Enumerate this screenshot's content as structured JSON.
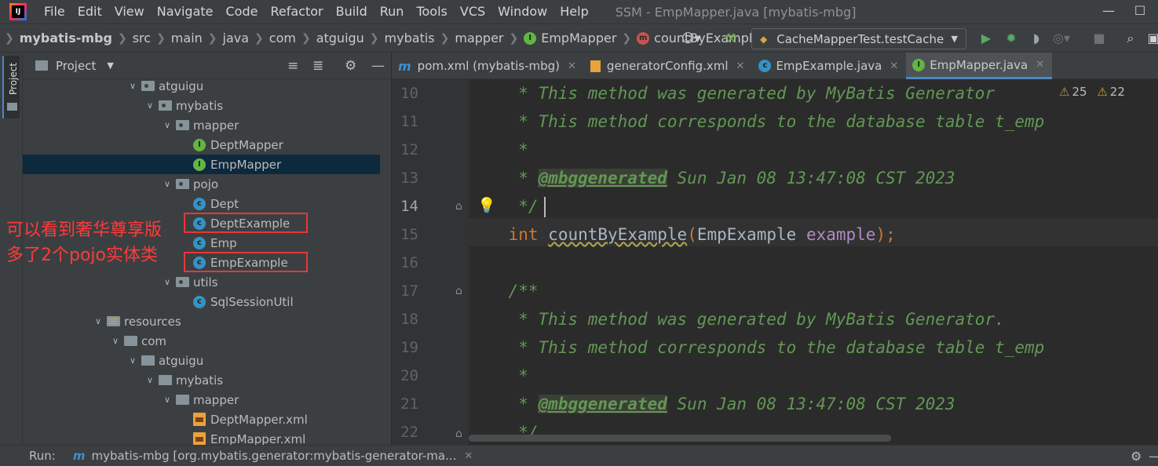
{
  "menubar": {
    "items": [
      "File",
      "Edit",
      "View",
      "Navigate",
      "Code",
      "Refactor",
      "Build",
      "Run",
      "Tools",
      "VCS",
      "Window",
      "Help"
    ],
    "window_title": "SSM - EmpMapper.java [mybatis-mbg]"
  },
  "breadcrumbs": [
    "mybatis-mbg",
    "src",
    "main",
    "java",
    "com",
    "atguigu",
    "mybatis",
    "mapper",
    "EmpMapper",
    "countByExample"
  ],
  "toolbar": {
    "run_config": "CacheMapperTest.testCache"
  },
  "project_panel": {
    "title": "Project",
    "strip_label": "Project",
    "tree": [
      {
        "label": "atguigu",
        "indent": 2,
        "type": "package",
        "expanded": true
      },
      {
        "label": "mybatis",
        "indent": 3,
        "type": "package",
        "expanded": true
      },
      {
        "label": "mapper",
        "indent": 4,
        "type": "package",
        "expanded": true
      },
      {
        "label": "DeptMapper",
        "indent": 5,
        "type": "interface"
      },
      {
        "label": "EmpMapper",
        "indent": 5,
        "type": "interface",
        "selected": true
      },
      {
        "label": "pojo",
        "indent": 4,
        "type": "package",
        "expanded": true
      },
      {
        "label": "Dept",
        "indent": 5,
        "type": "class"
      },
      {
        "label": "DeptExample",
        "indent": 5,
        "type": "class",
        "highlight": true
      },
      {
        "label": "Emp",
        "indent": 5,
        "type": "class"
      },
      {
        "label": "EmpExample",
        "indent": 5,
        "type": "class",
        "highlight": true
      },
      {
        "label": "utils",
        "indent": 4,
        "type": "package",
        "expanded": true
      },
      {
        "label": "SqlSessionUtil",
        "indent": 5,
        "type": "class"
      },
      {
        "label": "resources",
        "indent": 0,
        "type": "resources",
        "expanded": true
      },
      {
        "label": "com",
        "indent": 1,
        "type": "folder",
        "expanded": true
      },
      {
        "label": "atguigu",
        "indent": 2,
        "type": "folder",
        "expanded": true
      },
      {
        "label": "mybatis",
        "indent": 3,
        "type": "folder",
        "expanded": true
      },
      {
        "label": "mapper",
        "indent": 4,
        "type": "folder",
        "expanded": true
      },
      {
        "label": "DeptMapper.xml",
        "indent": 5,
        "type": "xml"
      },
      {
        "label": "EmpMapper.xml",
        "indent": 5,
        "type": "xml"
      }
    ]
  },
  "annotation": {
    "line1": "可以看到奢华尊享版",
    "line2": "多了2个pojo实体类"
  },
  "editor": {
    "tabs": [
      {
        "label": "pom.xml (mybatis-mbg)",
        "icon": "maven-icon",
        "active": false
      },
      {
        "label": "generatorConfig.xml",
        "icon": "xml-icon",
        "active": false
      },
      {
        "label": "EmpExample.java",
        "icon": "class-icon",
        "active": false
      },
      {
        "label": "EmpMapper.java",
        "icon": "interface-icon",
        "active": true
      }
    ],
    "inspection": {
      "weak_warnings": "25",
      "warnings": "22"
    },
    "current_line": 14,
    "lines": [
      {
        "no": "10",
        "kind": "doc",
        "text": "     * This method was generated by MyBatis Generator"
      },
      {
        "no": "11",
        "kind": "doc",
        "text": "     * This method corresponds to the database table t_emp"
      },
      {
        "no": "12",
        "kind": "doc",
        "text": "     *"
      },
      {
        "no": "13",
        "kind": "tagline",
        "prefix": "     * ",
        "tag": "@mbggenerated",
        "rest": " Sun Jan 08 13:47:08 CST 2023"
      },
      {
        "no": "14",
        "kind": "doc",
        "text": "     */"
      },
      {
        "no": "15",
        "kind": "method",
        "kw": "int",
        "name": "countByExample",
        "type": "EmpExample",
        "param": "example"
      },
      {
        "no": "16",
        "kind": "blank",
        "text": ""
      },
      {
        "no": "17",
        "kind": "doc",
        "text": "    /**"
      },
      {
        "no": "18",
        "kind": "doc",
        "text": "     * This method was generated by MyBatis Generator."
      },
      {
        "no": "19",
        "kind": "doc",
        "text": "     * This method corresponds to the database table t_emp"
      },
      {
        "no": "20",
        "kind": "doc",
        "text": "     *"
      },
      {
        "no": "21",
        "kind": "tagline",
        "prefix": "     * ",
        "tag": "@mbggenerated",
        "rest": " Sun Jan 08 13:47:08 CST 2023"
      },
      {
        "no": "22",
        "kind": "doc",
        "text": "     */"
      }
    ]
  },
  "run_bar": {
    "label": "Run:",
    "tab": "mybatis-mbg [org.mybatis.generator:mybatis-generator-ma..."
  }
}
